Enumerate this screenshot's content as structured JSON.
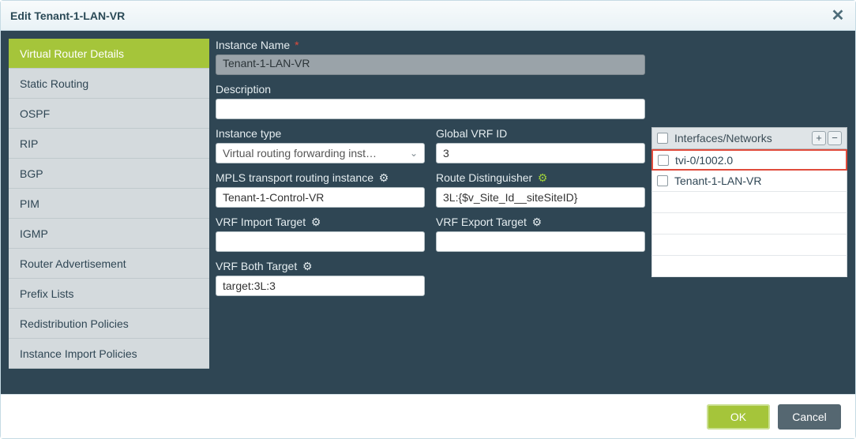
{
  "header": {
    "title": "Edit Tenant-1-LAN-VR"
  },
  "sidenav": {
    "items": [
      {
        "label": "Virtual Router Details",
        "active": true
      },
      {
        "label": "Static Routing"
      },
      {
        "label": "OSPF"
      },
      {
        "label": "RIP"
      },
      {
        "label": "BGP"
      },
      {
        "label": "PIM"
      },
      {
        "label": "IGMP"
      },
      {
        "label": "Router Advertisement"
      },
      {
        "label": "Prefix Lists"
      },
      {
        "label": "Redistribution Policies"
      },
      {
        "label": "Instance Import Policies"
      }
    ]
  },
  "form": {
    "instance_name_label": "Instance Name",
    "required_marker": "*",
    "instance_name_value": "Tenant-1-LAN-VR",
    "description_label": "Description",
    "description_value": "",
    "instance_type_label": "Instance type",
    "instance_type_value": "Virtual routing forwarding inst…",
    "global_vrf_id_label": "Global VRF ID",
    "global_vrf_id_value": "3",
    "mpls_label": "MPLS transport routing instance",
    "mpls_value": "Tenant-1-Control-VR",
    "rd_label": "Route Distinguisher",
    "rd_value": "3L:{$v_Site_Id__siteSiteID}",
    "vrf_import_label": "VRF Import Target",
    "vrf_import_value": "",
    "vrf_export_label": "VRF Export Target",
    "vrf_export_value": "",
    "vrf_both_label": "VRF Both Target",
    "vrf_both_value": "target:3L:3"
  },
  "interfaces": {
    "header": "Interfaces/Networks",
    "rows": [
      {
        "label": "tvi-0/1002.0",
        "highlight": true
      },
      {
        "label": "Tenant-1-LAN-VR"
      }
    ]
  },
  "footer": {
    "ok": "OK",
    "cancel": "Cancel"
  },
  "icons": {
    "gear": "⚙",
    "plus": "+",
    "minus": "−",
    "close": "✕",
    "chev": "⌄"
  }
}
